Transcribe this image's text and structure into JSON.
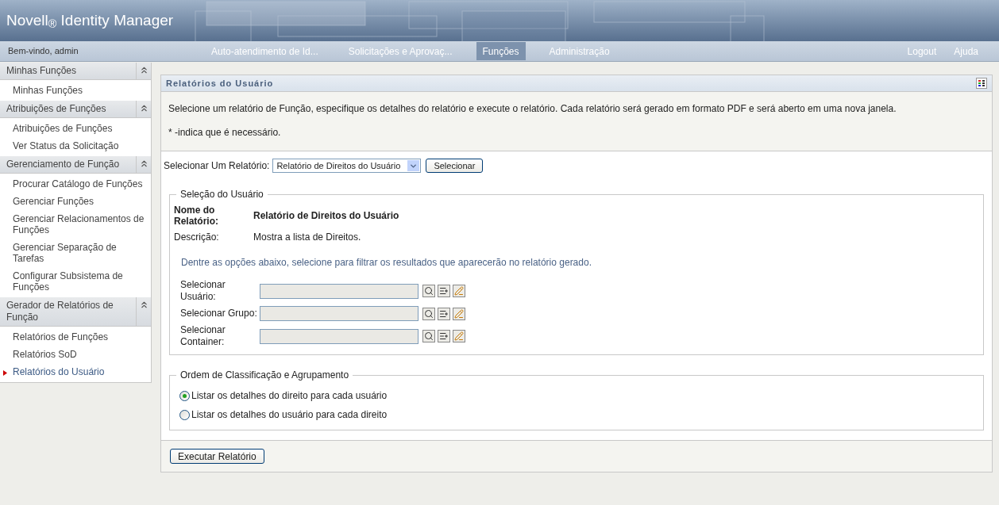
{
  "header": {
    "title": "Novell$_{®}$ Identity Manager"
  },
  "nav": {
    "welcome": "Bem-vindo, admin",
    "tabs": [
      {
        "label": "Auto-atendimento de Id...",
        "selected": false
      },
      {
        "label": "Solicitações e Aprovaç...",
        "selected": false
      },
      {
        "label": "Funções",
        "selected": true
      },
      {
        "label": "Administração",
        "selected": false
      }
    ],
    "links": [
      "Logout",
      "Ajuda"
    ]
  },
  "sidebar": {
    "sections": [
      {
        "title": "Minhas Funções",
        "expanded": true,
        "items": [
          {
            "label": "Minhas Funções",
            "selected": false
          }
        ]
      },
      {
        "title": "Atribuições de Funções",
        "expanded": true,
        "items": [
          {
            "label": "Atribuições de Funções",
            "selected": false
          },
          {
            "label": "Ver Status da Solicitação",
            "selected": false
          }
        ]
      },
      {
        "title": "Gerenciamento de Função",
        "expanded": true,
        "items": [
          {
            "label": "Procurar Catálogo de Funções",
            "selected": false
          },
          {
            "label": "Gerenciar Funções",
            "selected": false
          },
          {
            "label": "Gerenciar Relacionamentos de Funções",
            "selected": false
          },
          {
            "label": "Gerenciar Separação de Tarefas",
            "selected": false
          },
          {
            "label": "Configurar Subsistema de Funções",
            "selected": false
          }
        ]
      },
      {
        "title": "Gerador de Relatórios de Função",
        "expanded": true,
        "items": [
          {
            "label": "Relatórios de Funções",
            "selected": false
          },
          {
            "label": "Relatórios SoD",
            "selected": false
          },
          {
            "label": "Relatórios do Usuário",
            "selected": true
          }
        ]
      }
    ]
  },
  "panel": {
    "title": "Relatórios do Usuário",
    "intro": "Selecione um relatório de Função, especifique os detalhes do relatório e execute o relatório. Cada relatório será gerado em formato PDF e será aberto em uma nova janela.",
    "required_note": "* -indica que é necessário.",
    "report_select": {
      "label": "Selecionar Um Relatório:",
      "value": "Relatório de Direitos do Usuário",
      "button": "Selecionar"
    },
    "user_selection": {
      "legend": "Seleção do Usuário",
      "name_label": "Nome do Relatório:",
      "name_value": "Relatório de Direitos do Usuário",
      "desc_label": "Descrição:",
      "desc_value": "Mostra a lista de Direitos.",
      "hint": "Dentre as opções abaixo, selecione para filtrar os resultados que aparecerão no relatório gerado.",
      "fields": [
        {
          "label": "Selecionar Usuário:"
        },
        {
          "label": "Selecionar Grupo:"
        },
        {
          "label": "Selecionar Container:"
        }
      ]
    },
    "sort": {
      "legend": "Ordem de Classificação e Agrupamento",
      "options": [
        {
          "label": "Listar os detalhes do direito para cada usuário",
          "selected": true
        },
        {
          "label": "Listar os detalhes do usuário para cada direito",
          "selected": false
        }
      ]
    },
    "run_button": "Executar Relatório"
  }
}
